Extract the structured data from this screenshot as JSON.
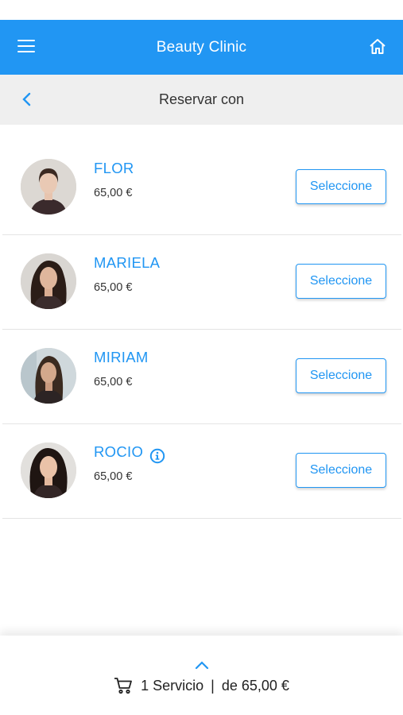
{
  "header": {
    "title": "Beauty Clinic",
    "menu_icon": "hamburger-menu-icon",
    "home_icon": "home-icon",
    "color": "#2196f3"
  },
  "subheader": {
    "title": "Reservar con",
    "back_icon": "chevron-left-icon"
  },
  "staff": [
    {
      "name": "FLOR",
      "price": "65,00 €",
      "button": "Seleccione"
    },
    {
      "name": "MARIELA",
      "price": "65,00 €",
      "button": "Seleccione"
    },
    {
      "name": "MIRIAM",
      "price": "65,00 €",
      "button": "Seleccione"
    },
    {
      "name": "ROCIO",
      "price": "65,00 €",
      "button": "Seleccione",
      "info_icon": "info-icon"
    }
  ],
  "footer": {
    "expand_icon": "chevron-up-icon",
    "cart_icon": "cart-icon",
    "services": "1 Servicio",
    "separator": "|",
    "total": "de 65,00 €"
  }
}
